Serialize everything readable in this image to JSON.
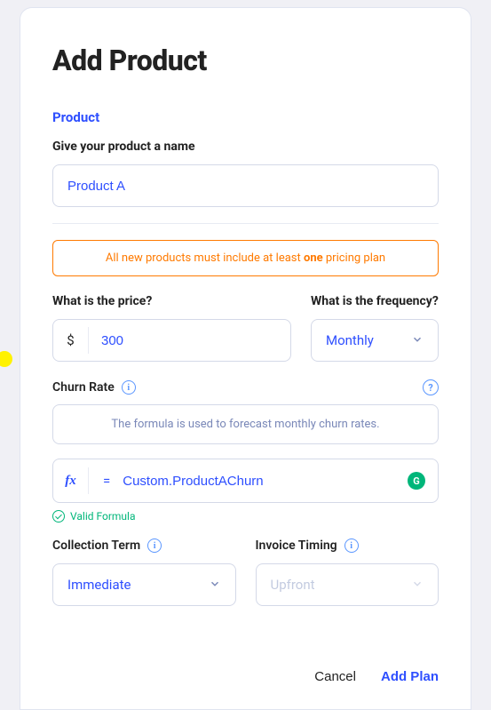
{
  "modal": {
    "title": "Add Product",
    "section_label": "Product",
    "name_label": "Give your product a name",
    "name_value": "Product A",
    "warning_prefix": "All new products must include at least ",
    "warning_bold": "one",
    "warning_suffix": " pricing plan",
    "price_label": "What is the price?",
    "price_currency": "$",
    "price_value": "300",
    "frequency_label": "What is the frequency?",
    "frequency_value": "Monthly",
    "churn_label": "Churn Rate",
    "churn_info": "The formula is used to forecast monthly churn rates.",
    "fx_label": "fx",
    "formula_eq": "=",
    "formula_value": "Custom.ProductAChurn",
    "valid_text": "Valid Formula",
    "collection_label": "Collection Term",
    "collection_value": "Immediate",
    "invoice_label": "Invoice Timing",
    "invoice_value": "Upfront",
    "cancel_label": "Cancel",
    "add_label": "Add Plan"
  }
}
